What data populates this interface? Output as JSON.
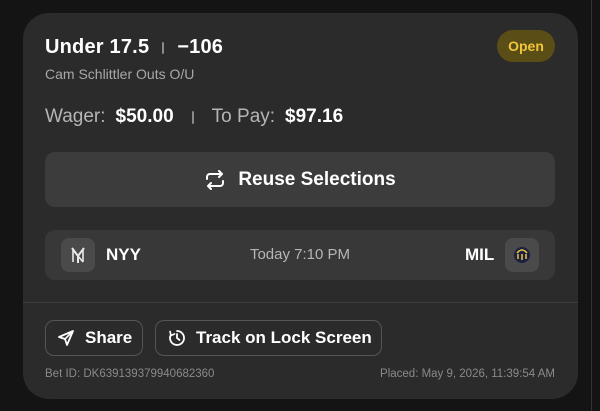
{
  "bet": {
    "selection": "Under 17.5",
    "odds": "−106",
    "market": "Cam Schlittler Outs O/U",
    "status": "Open",
    "wager_label": "Wager:",
    "wager_value": "$50.00",
    "topay_label": "To Pay:",
    "topay_value": "$97.16"
  },
  "actions": {
    "reuse_label": "Reuse Selections",
    "share_label": "Share",
    "track_label": "Track on Lock Screen"
  },
  "game": {
    "away_team": "NYY",
    "home_team": "MIL",
    "time": "Today 7:10 PM",
    "away_logo_icon": "yankees-logo-icon",
    "home_logo_icon": "brewers-logo-icon"
  },
  "footer": {
    "bet_id": "Bet ID: DK639139379940682360",
    "placed": "Placed: May 9, 2026, 11:39:54 AM"
  },
  "colors": {
    "background": "#141414",
    "card": "#2b2b2b",
    "badge_bg": "#5a4d16",
    "badge_text": "#f0c63a"
  }
}
